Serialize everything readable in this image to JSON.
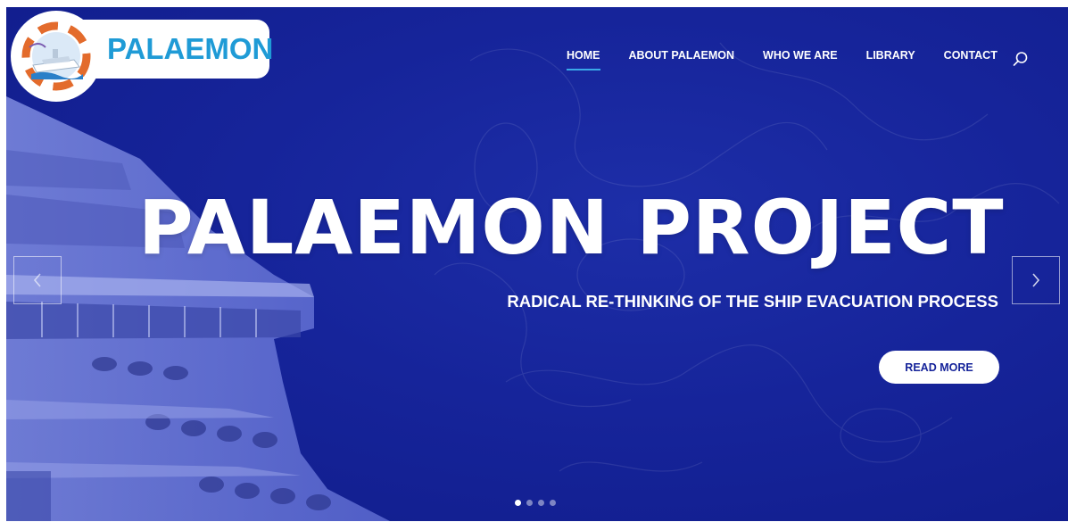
{
  "logo": {
    "text": "PALAEMON"
  },
  "nav": {
    "items": [
      {
        "label": "HOME",
        "active": true
      },
      {
        "label": "ABOUT PALAEMON",
        "active": false
      },
      {
        "label": "WHO WE ARE",
        "active": false
      },
      {
        "label": "LIBRARY",
        "active": false
      },
      {
        "label": "CONTACT",
        "active": false
      }
    ],
    "search_icon": "search-icon"
  },
  "hero": {
    "title": "PALAEMON PROJECT",
    "subtitle": "RADICAL RE-THINKING OF THE SHIP EVACUATION PROCESS",
    "cta_label": "READ MORE",
    "prev_icon": "chevron-left-icon",
    "next_icon": "chevron-right-icon"
  },
  "slider": {
    "slide_count": 4,
    "active_index": 0
  },
  "colors": {
    "background": "#16249a",
    "logo_text": "#1f9bd6",
    "nav_active_underline": "#3aa9e8",
    "button_bg": "#ffffff",
    "button_text": "#16249a"
  }
}
